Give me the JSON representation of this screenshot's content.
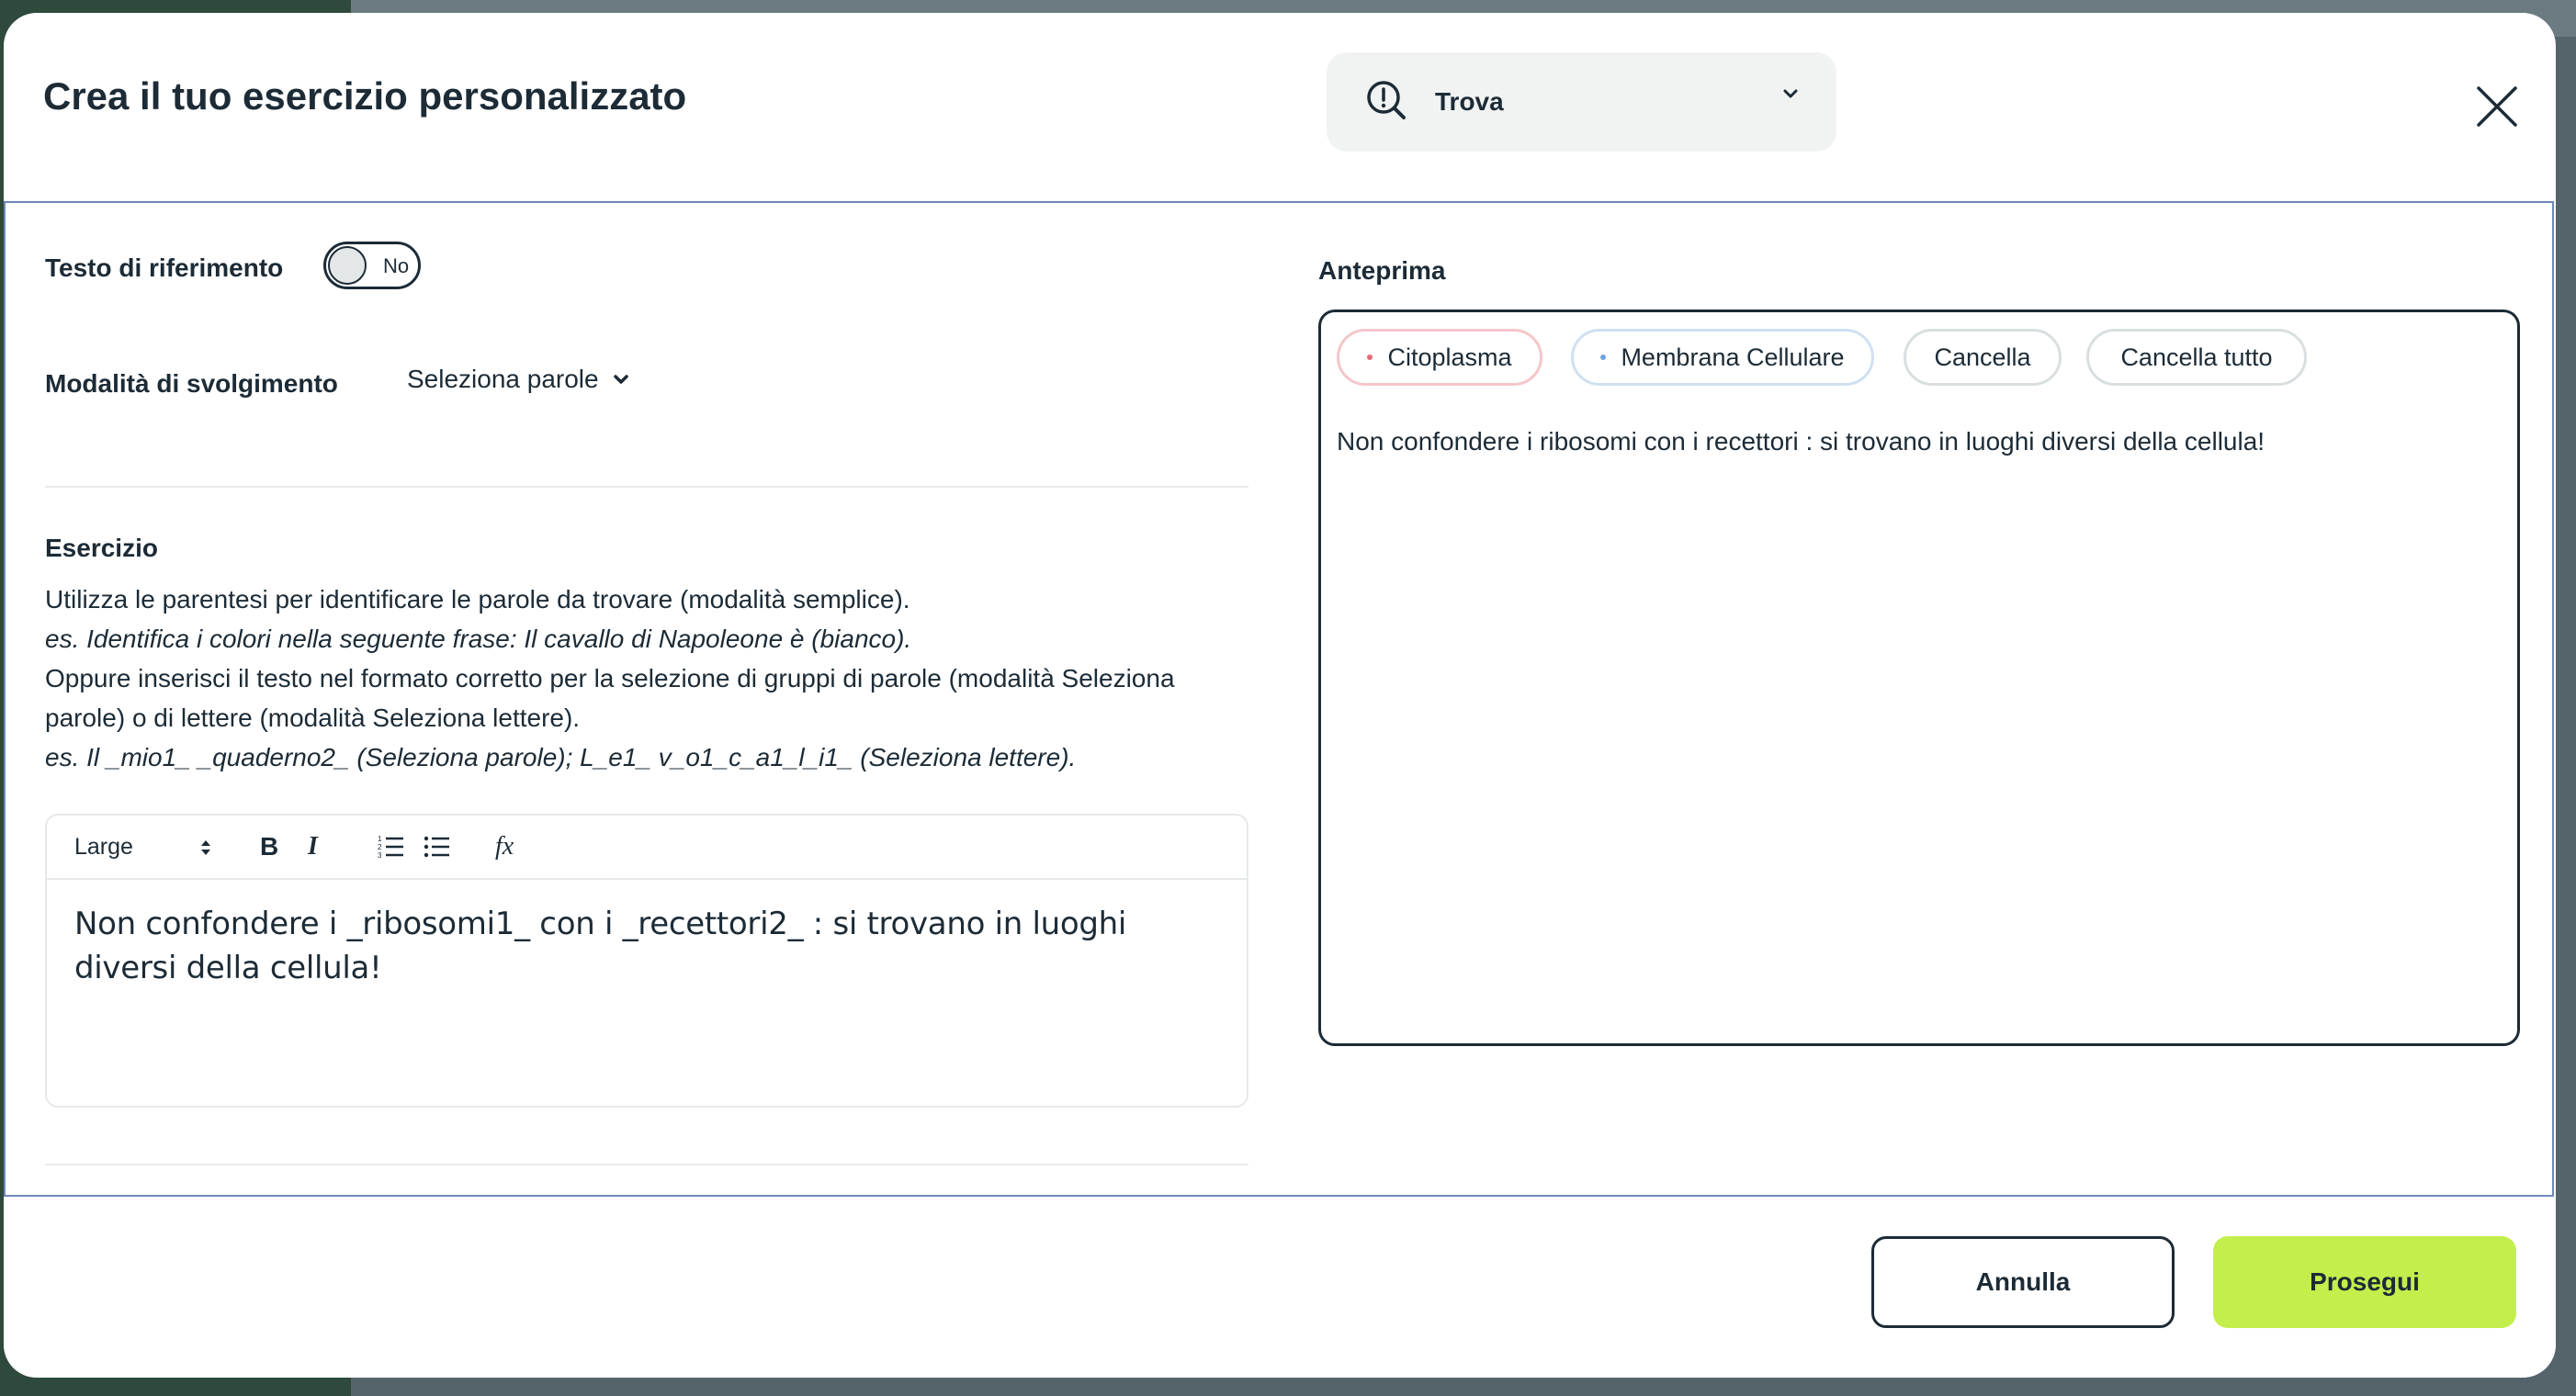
{
  "modal": {
    "title": "Crea il tuo esercizio personalizzato",
    "mode_select": {
      "selected": "Trova",
      "icon": "search-question-icon"
    },
    "close_icon": "close-icon"
  },
  "form": {
    "reference_text": {
      "label": "Testo di riferimento",
      "toggle_value": "No"
    },
    "mode": {
      "label": "Modalità di svolgimento",
      "selected": "Seleziona parole"
    },
    "exercise": {
      "label": "Esercizio",
      "instructions": {
        "line1": "Utilizza le parentesi per identificare le parole da trovare (modalità semplice).",
        "example1": "es. Identifica i colori nella seguente frase: Il cavallo di Napoleone è (bianco).",
        "line2": "Oppure inserisci il testo nel formato corretto per la selezione di gruppi di parole (modalità Seleziona parole) o di lettere (modalità Seleziona lettere).",
        "example2": "es. Il _mio1_ _quaderno2_ (Seleziona parole); L_e1_ v_o1_c_a1_l_i1_ (Seleziona lettere)."
      },
      "editor": {
        "toolbar": {
          "size": "Large",
          "bold": "B",
          "italic": "I",
          "formula": "fx",
          "ordered_list_icon": "ordered-list-icon",
          "bullet_list_icon": "bullet-list-icon"
        },
        "content": "Non confondere i _ribosomi1_ con i _recettori2_ : si trovano in luoghi diversi della cellula!"
      }
    }
  },
  "preview": {
    "label": "Anteprima",
    "chips": [
      {
        "label": "Citoplasma",
        "color": "#e36b77"
      },
      {
        "label": "Membrana Cellulare",
        "color": "#6fa3dc"
      },
      {
        "label": "Cancella"
      },
      {
        "label": "Cancella tutto"
      }
    ],
    "text": "Non confondere i ribosomi con i recettori : si trovano in luoghi diversi della cellula!"
  },
  "footer": {
    "cancel_label": "Annulla",
    "next_label": "Prosegui",
    "accent": "#c4ee4c"
  }
}
